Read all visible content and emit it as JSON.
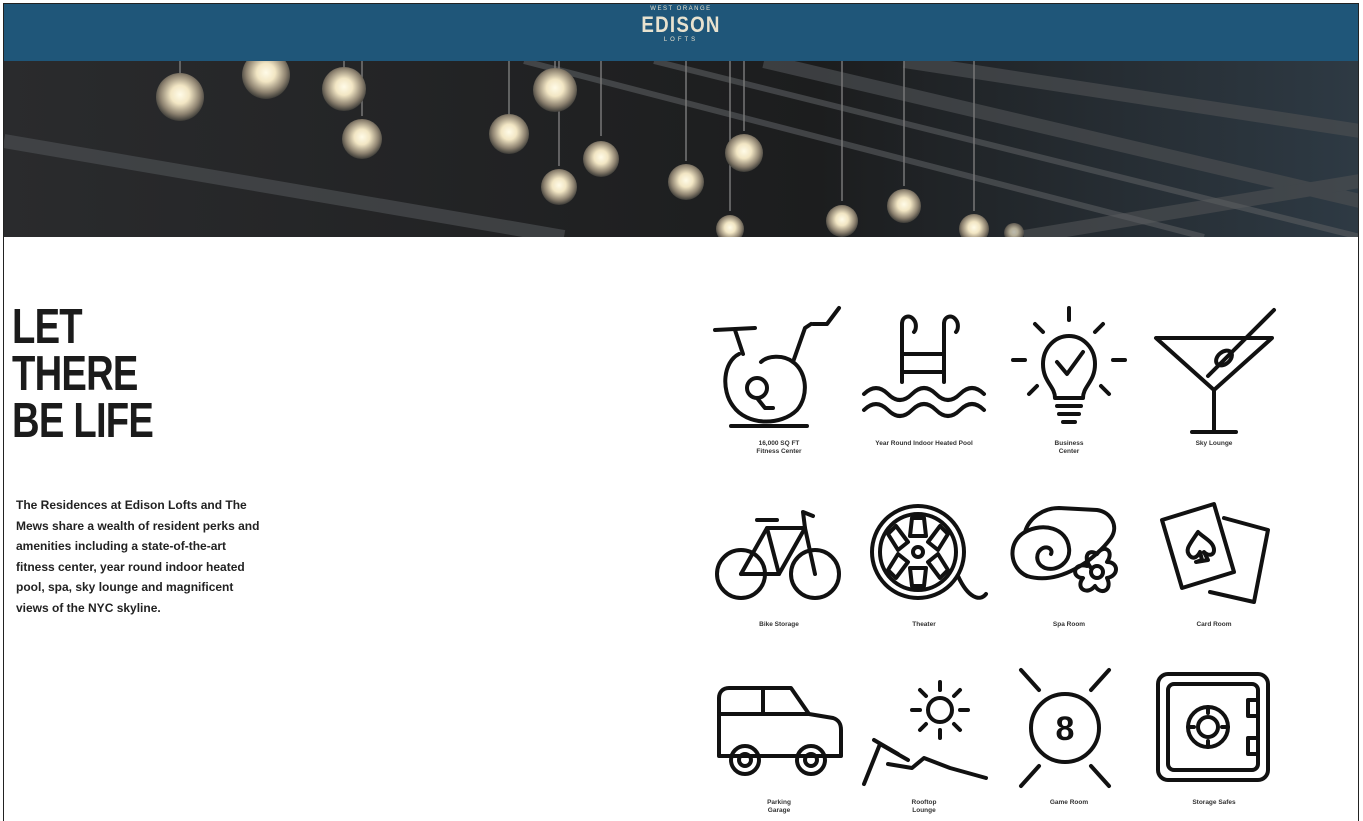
{
  "header": {
    "brand_small": "WEST ORANGE",
    "brand_name": "EDISON",
    "brand_sub": "LOFTS",
    "background_color": "#1f5679"
  },
  "hero": {
    "image_subject": "pendant globe light bulbs"
  },
  "headline": {
    "line1": "LET",
    "line2": "THERE",
    "line3": "BE LIFE"
  },
  "intro": {
    "text": "The Residences at Edison Lofts and The Mews share a wealth of resident perks and amenities including a state-of-the-art fitness center, year round indoor heated pool, spa, sky lounge and magnificent views of the NYC skyline."
  },
  "amenities": [
    {
      "icon": "exercise-bike-icon",
      "label": "16,000 SQ FT\nFitness Center"
    },
    {
      "icon": "pool-ladder-icon",
      "label": "Year Round Indoor Heated Pool"
    },
    {
      "icon": "lightbulb-check-icon",
      "label": "Business\nCenter"
    },
    {
      "icon": "martini-glass-icon",
      "label": "Sky Lounge"
    },
    {
      "icon": "bicycle-icon",
      "label": "Bike Storage"
    },
    {
      "icon": "film-reel-icon",
      "label": "Theater"
    },
    {
      "icon": "spa-towel-flower-icon",
      "label": "Spa Room"
    },
    {
      "icon": "playing-cards-icon",
      "label": "Card Room"
    },
    {
      "icon": "car-icon",
      "label": "Parking\nGarage"
    },
    {
      "icon": "sun-lounge-chair-icon",
      "label": "Rooftop\nLounge"
    },
    {
      "icon": "eight-ball-icon",
      "label": "Game Room"
    },
    {
      "icon": "safe-icon",
      "label": "Storage Safes"
    }
  ],
  "colors": {
    "icon_stroke": "#111111",
    "text": "#1b1b1b"
  }
}
